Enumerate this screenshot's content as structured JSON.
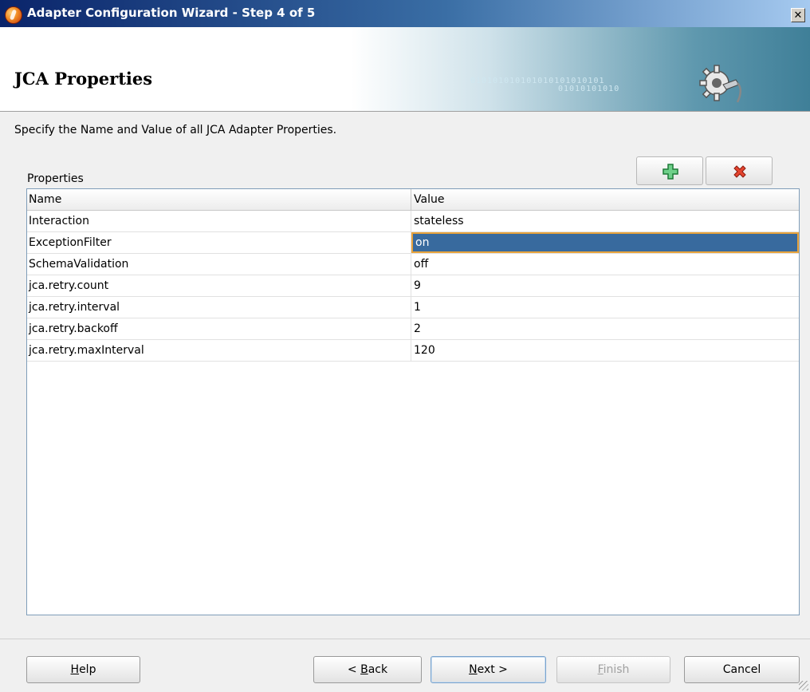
{
  "window": {
    "title": "Adapter Configuration Wizard - Step 4 of 5",
    "close_glyph": "✕",
    "icon": "oracle-adapter-icon"
  },
  "banner": {
    "title": "JCA Properties",
    "decoration_text_1": "010101010101010101010101",
    "decoration_text_2": "01010101010",
    "icon": "gear-plug-icon"
  },
  "instruction": "Specify the Name and Value of all JCA Adapter Properties.",
  "properties": {
    "label": "Properties",
    "add_icon": "add-icon",
    "delete_icon": "delete-icon",
    "columns": [
      "Name",
      "Value"
    ],
    "rows": [
      {
        "name": "Interaction",
        "value": "stateless"
      },
      {
        "name": "ExceptionFilter",
        "value": "on",
        "selected": true
      },
      {
        "name": "SchemaValidation",
        "value": "off"
      },
      {
        "name": "jca.retry.count",
        "value": "9"
      },
      {
        "name": "jca.retry.interval",
        "value": "1"
      },
      {
        "name": "jca.retry.backoff",
        "value": "2"
      },
      {
        "name": "jca.retry.maxInterval",
        "value": "120"
      }
    ]
  },
  "buttons": {
    "help": {
      "label": "Help",
      "mnemonic": "H",
      "rest": "elp"
    },
    "back": {
      "prefix": "< ",
      "mnemonic": "B",
      "rest": "ack"
    },
    "next": {
      "mnemonic": "N",
      "rest": "ext >"
    },
    "finish": {
      "mnemonic": "F",
      "rest": "inish",
      "enabled": false
    },
    "cancel": {
      "label": "Cancel"
    }
  },
  "colors": {
    "selection": "#386a9e",
    "selection_border": "#e8a33c",
    "add_icon": "#2aa84a",
    "delete_icon": "#d62a1a"
  }
}
